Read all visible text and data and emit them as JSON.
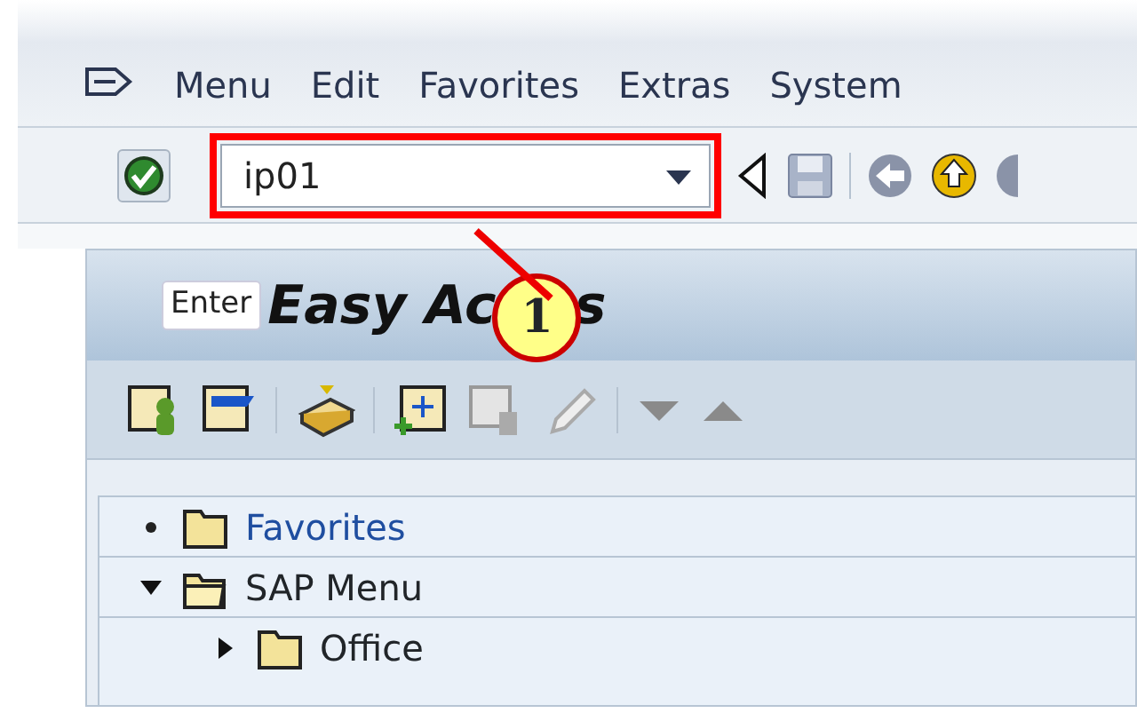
{
  "menu_bar": {
    "items": [
      {
        "label": "Menu"
      },
      {
        "label": "Edit"
      },
      {
        "label": "Favorites"
      },
      {
        "label": "Extras"
      },
      {
        "label": "System"
      }
    ]
  },
  "command_field": {
    "value": "ip01",
    "highlighted": true
  },
  "tooltip": "Enter",
  "callout": "1",
  "title_fragments": [
    "Easy Ac",
    "s"
  ],
  "tree": [
    {
      "label": "Favorites",
      "kind": "leaf"
    },
    {
      "label": "SAP Menu",
      "kind": "folder",
      "expanded": true,
      "children": [
        {
          "label": "Office",
          "kind": "folder",
          "expanded": false
        }
      ]
    }
  ]
}
